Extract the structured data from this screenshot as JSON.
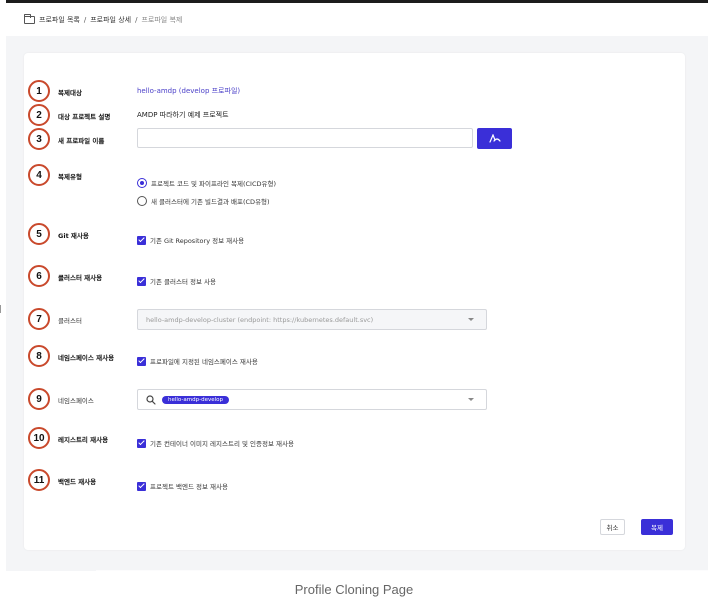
{
  "breadcrumb": {
    "items": [
      "프로파일 목록",
      "프로파일 상세"
    ],
    "current": "프로파일 복제",
    "separator": "/"
  },
  "form": {
    "rows": [
      {
        "num": "1",
        "label": "복제대상",
        "value": "hello-amdp (develop 프로파일)"
      },
      {
        "num": "2",
        "label": "대상 프로젝트 설명",
        "value": "AMDP 따라하기 예제 프로젝트"
      },
      {
        "num": "3",
        "label": "새 프로파일 이름",
        "input_value": ""
      },
      {
        "num": "4",
        "label": "복제유형",
        "options": [
          "프로젝트 코드 및 파이프라인 복제(CICD유형)",
          "새 클러스터에 기존 빌드결과 배포(CD유형)"
        ],
        "selected": 0
      },
      {
        "num": "5",
        "label": "Git 재사용",
        "check": "기존 Git Repository 정보 재사용"
      },
      {
        "num": "6",
        "label": "클러스터 재사용",
        "check": "기존 클러스터 정보 사용"
      },
      {
        "num": "7",
        "label": "클러스터",
        "select_value": "hello-amdp-develop-cluster (endpoint: https://kubernetes.default.svc)"
      },
      {
        "num": "8",
        "label": "네임스페이스 재사용",
        "check": "프로파일에 지정된 네임스페이스 재사용"
      },
      {
        "num": "9",
        "label": "네임스페이스",
        "chip": "hello-amdp-develop"
      },
      {
        "num": "10",
        "label": "레지스트리 재사용",
        "check": "기존 컨테이너 이미지 레지스트리 및 인증정보 재사용"
      },
      {
        "num": "11",
        "label": "백엔드 재사용",
        "check": "프로젝트 백엔드 정보 재사용"
      }
    ]
  },
  "actions": {
    "cancel": "취소",
    "submit": "복제"
  },
  "caption": "Profile Cloning Page",
  "colors": {
    "accent": "#3a2fd8",
    "marker": "#c9492c",
    "link": "#4a3fc8"
  }
}
